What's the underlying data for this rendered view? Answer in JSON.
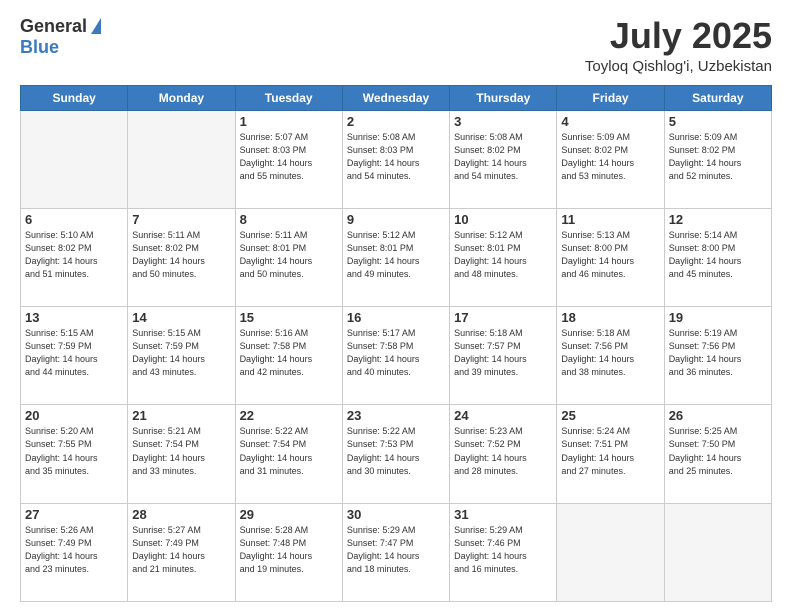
{
  "header": {
    "logo_general": "General",
    "logo_blue": "Blue",
    "title": "July 2025",
    "subtitle": "Toyloq Qishlog'i, Uzbekistan"
  },
  "days_of_week": [
    "Sunday",
    "Monday",
    "Tuesday",
    "Wednesday",
    "Thursday",
    "Friday",
    "Saturday"
  ],
  "weeks": [
    [
      {
        "day": "",
        "info": ""
      },
      {
        "day": "",
        "info": ""
      },
      {
        "day": "1",
        "info": "Sunrise: 5:07 AM\nSunset: 8:03 PM\nDaylight: 14 hours\nand 55 minutes."
      },
      {
        "day": "2",
        "info": "Sunrise: 5:08 AM\nSunset: 8:03 PM\nDaylight: 14 hours\nand 54 minutes."
      },
      {
        "day": "3",
        "info": "Sunrise: 5:08 AM\nSunset: 8:02 PM\nDaylight: 14 hours\nand 54 minutes."
      },
      {
        "day": "4",
        "info": "Sunrise: 5:09 AM\nSunset: 8:02 PM\nDaylight: 14 hours\nand 53 minutes."
      },
      {
        "day": "5",
        "info": "Sunrise: 5:09 AM\nSunset: 8:02 PM\nDaylight: 14 hours\nand 52 minutes."
      }
    ],
    [
      {
        "day": "6",
        "info": "Sunrise: 5:10 AM\nSunset: 8:02 PM\nDaylight: 14 hours\nand 51 minutes."
      },
      {
        "day": "7",
        "info": "Sunrise: 5:11 AM\nSunset: 8:02 PM\nDaylight: 14 hours\nand 50 minutes."
      },
      {
        "day": "8",
        "info": "Sunrise: 5:11 AM\nSunset: 8:01 PM\nDaylight: 14 hours\nand 50 minutes."
      },
      {
        "day": "9",
        "info": "Sunrise: 5:12 AM\nSunset: 8:01 PM\nDaylight: 14 hours\nand 49 minutes."
      },
      {
        "day": "10",
        "info": "Sunrise: 5:12 AM\nSunset: 8:01 PM\nDaylight: 14 hours\nand 48 minutes."
      },
      {
        "day": "11",
        "info": "Sunrise: 5:13 AM\nSunset: 8:00 PM\nDaylight: 14 hours\nand 46 minutes."
      },
      {
        "day": "12",
        "info": "Sunrise: 5:14 AM\nSunset: 8:00 PM\nDaylight: 14 hours\nand 45 minutes."
      }
    ],
    [
      {
        "day": "13",
        "info": "Sunrise: 5:15 AM\nSunset: 7:59 PM\nDaylight: 14 hours\nand 44 minutes."
      },
      {
        "day": "14",
        "info": "Sunrise: 5:15 AM\nSunset: 7:59 PM\nDaylight: 14 hours\nand 43 minutes."
      },
      {
        "day": "15",
        "info": "Sunrise: 5:16 AM\nSunset: 7:58 PM\nDaylight: 14 hours\nand 42 minutes."
      },
      {
        "day": "16",
        "info": "Sunrise: 5:17 AM\nSunset: 7:58 PM\nDaylight: 14 hours\nand 40 minutes."
      },
      {
        "day": "17",
        "info": "Sunrise: 5:18 AM\nSunset: 7:57 PM\nDaylight: 14 hours\nand 39 minutes."
      },
      {
        "day": "18",
        "info": "Sunrise: 5:18 AM\nSunset: 7:56 PM\nDaylight: 14 hours\nand 38 minutes."
      },
      {
        "day": "19",
        "info": "Sunrise: 5:19 AM\nSunset: 7:56 PM\nDaylight: 14 hours\nand 36 minutes."
      }
    ],
    [
      {
        "day": "20",
        "info": "Sunrise: 5:20 AM\nSunset: 7:55 PM\nDaylight: 14 hours\nand 35 minutes."
      },
      {
        "day": "21",
        "info": "Sunrise: 5:21 AM\nSunset: 7:54 PM\nDaylight: 14 hours\nand 33 minutes."
      },
      {
        "day": "22",
        "info": "Sunrise: 5:22 AM\nSunset: 7:54 PM\nDaylight: 14 hours\nand 31 minutes."
      },
      {
        "day": "23",
        "info": "Sunrise: 5:22 AM\nSunset: 7:53 PM\nDaylight: 14 hours\nand 30 minutes."
      },
      {
        "day": "24",
        "info": "Sunrise: 5:23 AM\nSunset: 7:52 PM\nDaylight: 14 hours\nand 28 minutes."
      },
      {
        "day": "25",
        "info": "Sunrise: 5:24 AM\nSunset: 7:51 PM\nDaylight: 14 hours\nand 27 minutes."
      },
      {
        "day": "26",
        "info": "Sunrise: 5:25 AM\nSunset: 7:50 PM\nDaylight: 14 hours\nand 25 minutes."
      }
    ],
    [
      {
        "day": "27",
        "info": "Sunrise: 5:26 AM\nSunset: 7:49 PM\nDaylight: 14 hours\nand 23 minutes."
      },
      {
        "day": "28",
        "info": "Sunrise: 5:27 AM\nSunset: 7:49 PM\nDaylight: 14 hours\nand 21 minutes."
      },
      {
        "day": "29",
        "info": "Sunrise: 5:28 AM\nSunset: 7:48 PM\nDaylight: 14 hours\nand 19 minutes."
      },
      {
        "day": "30",
        "info": "Sunrise: 5:29 AM\nSunset: 7:47 PM\nDaylight: 14 hours\nand 18 minutes."
      },
      {
        "day": "31",
        "info": "Sunrise: 5:29 AM\nSunset: 7:46 PM\nDaylight: 14 hours\nand 16 minutes."
      },
      {
        "day": "",
        "info": ""
      },
      {
        "day": "",
        "info": ""
      }
    ]
  ]
}
